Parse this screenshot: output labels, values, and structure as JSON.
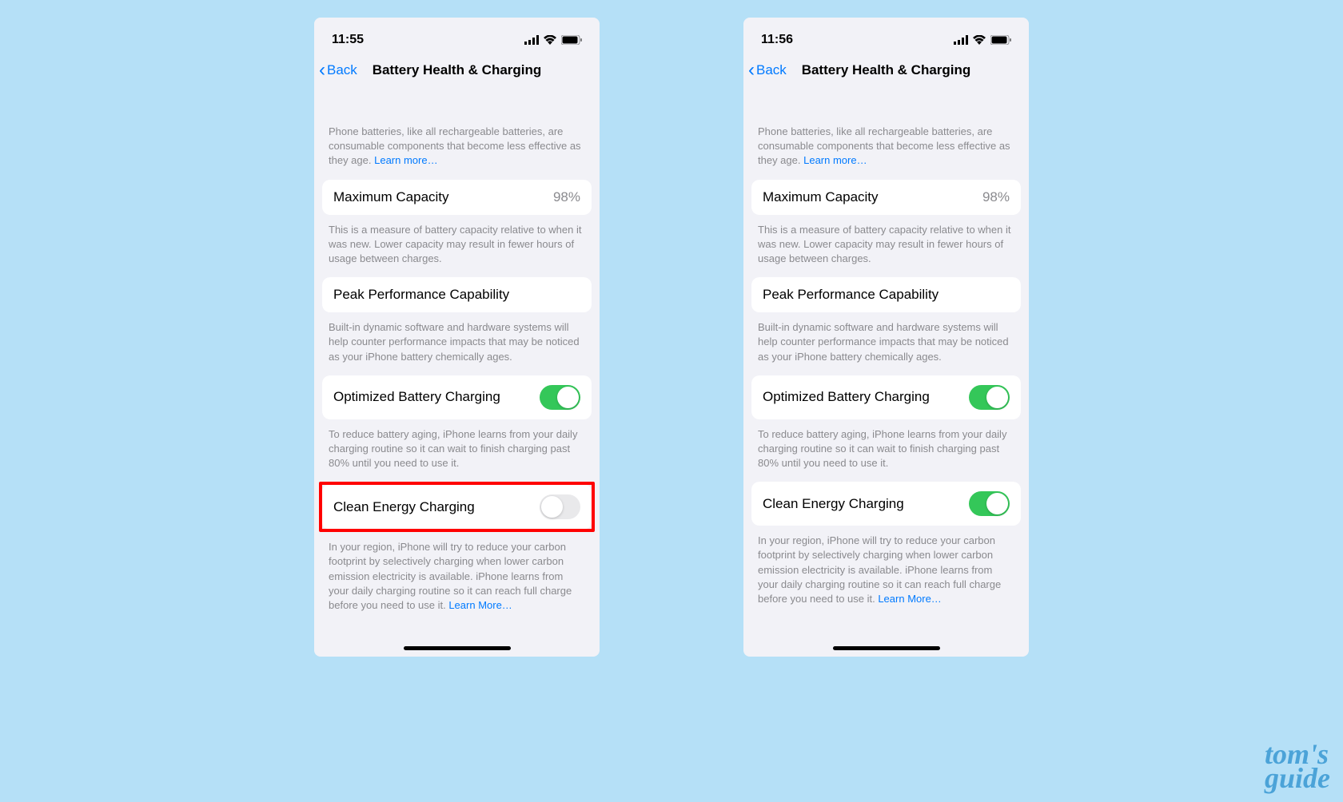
{
  "screens": [
    {
      "time": "11:55",
      "nav": {
        "back": "Back",
        "title": "Battery Health & Charging"
      },
      "intro": "Phone batteries, like all rechargeable batteries, are consumable components that become less effective as they age. ",
      "intro_link": "Learn more…",
      "capacity": {
        "label": "Maximum Capacity",
        "value": "98%",
        "desc": "This is a measure of battery capacity relative to when it was new. Lower capacity may result in fewer hours of usage between charges."
      },
      "peak": {
        "label": "Peak Performance Capability",
        "desc": "Built-in dynamic software and hardware systems will help counter performance impacts that may be noticed as your iPhone battery chemically ages."
      },
      "optimized": {
        "label": "Optimized Battery Charging",
        "desc": "To reduce battery aging, iPhone learns from your daily charging routine so it can wait to finish charging past 80% until you need to use it."
      },
      "clean": {
        "label": "Clean Energy Charging",
        "desc": "In your region, iPhone will try to reduce your carbon footprint by selectively charging when lower carbon emission electricity is available. iPhone learns from your daily charging routine so it can reach full charge before you need to use it. ",
        "link": "Learn More…"
      }
    },
    {
      "time": "11:56",
      "nav": {
        "back": "Back",
        "title": "Battery Health & Charging"
      },
      "intro": "Phone batteries, like all rechargeable batteries, are consumable components that become less effective as they age. ",
      "intro_link": "Learn more…",
      "capacity": {
        "label": "Maximum Capacity",
        "value": "98%",
        "desc": "This is a measure of battery capacity relative to when it was new. Lower capacity may result in fewer hours of usage between charges."
      },
      "peak": {
        "label": "Peak Performance Capability",
        "desc": "Built-in dynamic software and hardware systems will help counter performance impacts that may be noticed as your iPhone battery chemically ages."
      },
      "optimized": {
        "label": "Optimized Battery Charging",
        "desc": "To reduce battery aging, iPhone learns from your daily charging routine so it can wait to finish charging past 80% until you need to use it."
      },
      "clean": {
        "label": "Clean Energy Charging",
        "desc": "In your region, iPhone will try to reduce your carbon footprint by selectively charging when lower carbon emission electricity is available. iPhone learns from your daily charging routine so it can reach full charge before you need to use it. ",
        "link": "Learn More…"
      }
    }
  ],
  "watermark": {
    "line1": "tom's",
    "line2": "guide"
  }
}
